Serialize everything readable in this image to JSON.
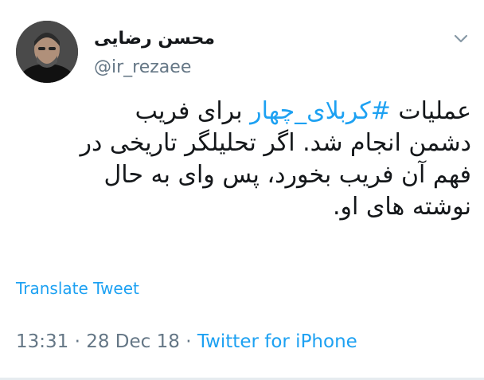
{
  "user": {
    "display_name": "محسن رضایی",
    "handle": "@ir_rezaee"
  },
  "tweet": {
    "line1": {
      "before": "عملیات ",
      "hashtag": "#کربلای_چهار",
      "after": " برای فریب"
    },
    "line2": "دشمن انجام شد. اگر تحلیلگر تاریخی  در",
    "line3": "فهم آن فریب بخورد، پس وای به حال",
    "line4": "نوشته های او."
  },
  "actions": {
    "translate_label": "Translate Tweet"
  },
  "meta": {
    "time": "13:31",
    "separator1": " · ",
    "date": "28 Dec 18",
    "separator2": " · ",
    "source": "Twitter for iPhone"
  },
  "colors": {
    "link": "#1da1f2",
    "secondary_text": "#657786",
    "primary_text": "#14171a"
  },
  "icons": {
    "caret": "chevron-down-icon"
  }
}
